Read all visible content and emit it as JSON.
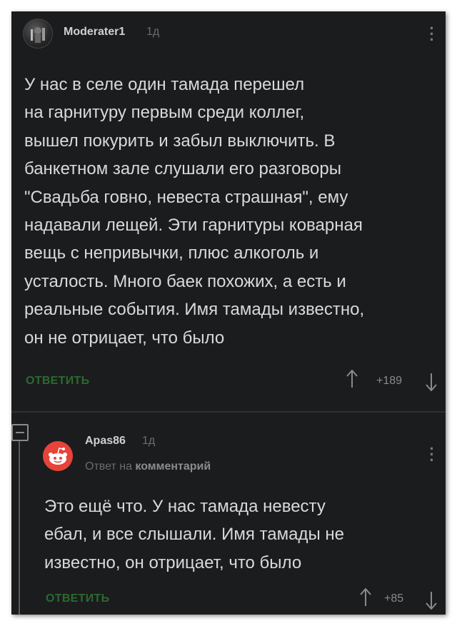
{
  "comment": {
    "username": "Moderater1",
    "time": "1д",
    "text": "У нас в селе один тамада перешел\nна гарнитуру первым среди коллег,\nвышел покурить и забыл выключить. В\nбанкетном зале слушали его разговоры\n\"Свадьба говно, невеста страшная\", ему\nнадавали лещей. Эти гарнитуры коварная\nвещь с непривычки, плюс алкоголь и\nусталость. Много баек похожих, а есть и\nреальные события. Имя тамады известно,\nон не отрицает, что было",
    "reply_label": "ОТВЕТИТЬ",
    "score": "+189",
    "upvote_icon": "arrow-up-icon",
    "downvote_icon": "arrow-down-icon"
  },
  "reply": {
    "username": "Apas86",
    "time": "1д",
    "sub_prefix": "Ответ на",
    "sub_target": "комментарий",
    "text": "Это ещё что. У нас тамада невесту\nебал, и все слышали. Имя тамады не\nизвестно, он отрицает, что было",
    "reply_label": "ОТВЕТИТЬ",
    "score": "+85",
    "avatar_icon": "reddit-alien-icon"
  },
  "colors": {
    "background": "#1b1c1e",
    "text": "#d9d9d9",
    "accent_green": "#2b6a2f",
    "muted": "#6c6c6c"
  }
}
